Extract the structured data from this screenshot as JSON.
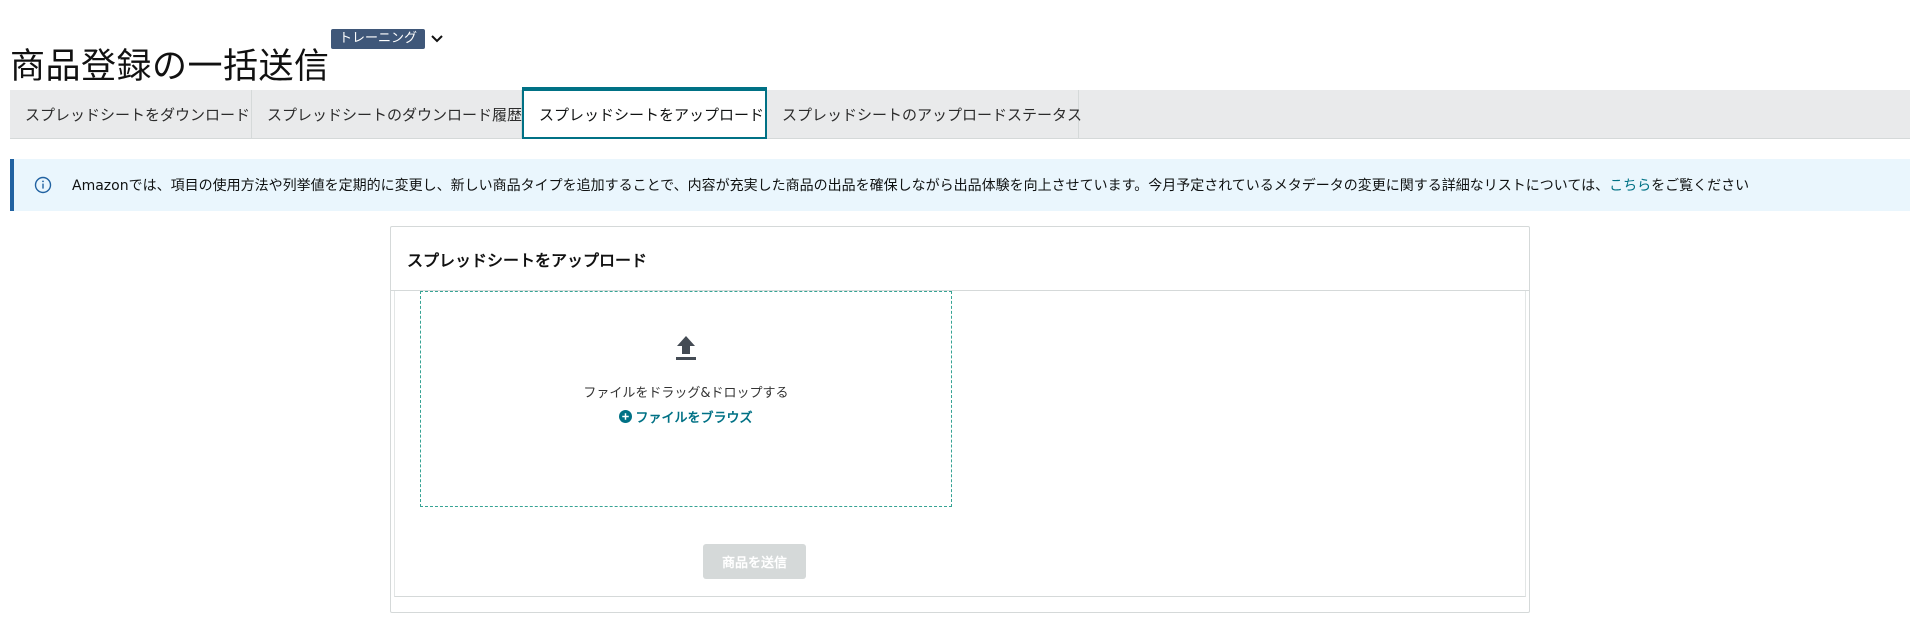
{
  "header": {
    "title": "商品登録の一括送信",
    "badge": "トレーニング"
  },
  "tabs": [
    {
      "label": "スプレッドシートをダウンロード",
      "active": false
    },
    {
      "label": "スプレッドシートのダウンロード履歴",
      "active": false
    },
    {
      "label": "スプレッドシートをアップロード",
      "active": true
    },
    {
      "label": "スプレッドシートのアップロードステータス",
      "active": false
    }
  ],
  "alert": {
    "icon": "info-icon",
    "text": "Amazonでは、項目の使用方法や列挙値を定期的に変更し、新しい商品タイプを追加することで、内容が充実した商品の出品を確保しながら出品体験を向上させています。今月予定されているメタデータの変更に関する詳細なリストについては、",
    "link": "こちら",
    "suffix": "をご覧ください"
  },
  "upload": {
    "title": "スプレッドシートをアップロード",
    "drop_text": "ファイルをドラッグ&ドロップする",
    "browse_label": "ファイルをブラウズ",
    "submit_label": "商品を送信"
  },
  "colors": {
    "accent": "#007185",
    "badge": "#3f5779",
    "alert_bg": "#eaf6fd",
    "alert_border": "#2162a1",
    "dropzone_border": "#36a394",
    "disabled_button": "#d5d9d9"
  }
}
